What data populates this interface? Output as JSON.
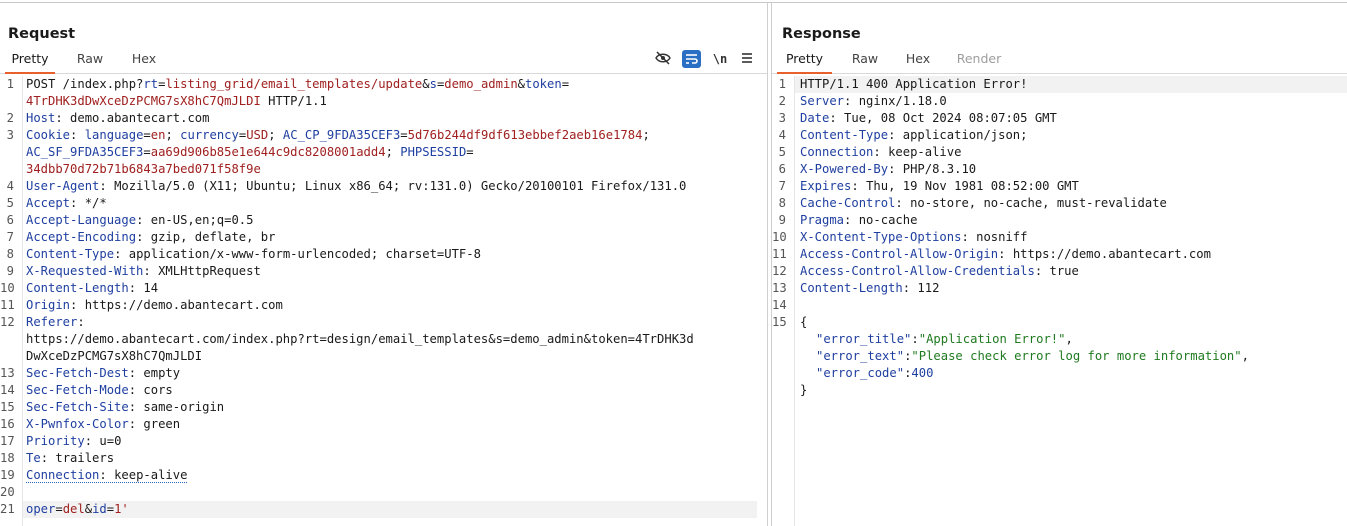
{
  "request": {
    "title": "Request",
    "tabs": [
      "Pretty",
      "Raw",
      "Hex"
    ],
    "toolbar_icons": [
      "eye-slash-icon",
      "wrap-lines-icon",
      "newline-icon",
      "menu-icon"
    ],
    "toolbar_newline_label": "\\n",
    "line_numbers": [
      "1",
      "2",
      "3",
      "4",
      "5",
      "6",
      "7",
      "8",
      "9",
      "10",
      "11",
      "12",
      "13",
      "14",
      "15",
      "16",
      "17",
      "18",
      "19",
      "20",
      "21"
    ],
    "lines": {
      "l1": {
        "method": "POST /index.php?",
        "rt_k": "rt",
        "eq": "=",
        "rt_v": "listing_grid/email_templates/update",
        "amp1": "&",
        "s_k": "s",
        "s_v": "demo_admin",
        "amp2": "&",
        "t_k": "token",
        "t_eq": "="
      },
      "l1b": {
        "token_v": "4TrDHK3dDwXceDzPCMG7sX8hC7QmJLDI",
        "proto": " HTTP/1.1"
      },
      "l2": {
        "k": "Host",
        "v": "demo.abantecart.com"
      },
      "l3": {
        "k": "Cookie",
        "c1k": "language",
        "c1v": "en",
        "c2k": "currency",
        "c2v": "USD",
        "c3k": "AC_CP_9FDA35CEF3",
        "c3v": "5d76b244df9df613ebbef2aeb16e1784"
      },
      "l3b": {
        "c4k": "AC_SF_9FDA35CEF3",
        "c4v": "aa69d906b85e1e644c9dc8208001add4",
        "c5k": "PHPSESSID"
      },
      "l3c": {
        "c5v": "34dbb70d72b71b6843a7bed071f58f9e"
      },
      "l4": {
        "k": "User-Agent",
        "v": "Mozilla/5.0 (X11; Ubuntu; Linux x86_64; rv:131.0) Gecko/20100101 Firefox/131.0"
      },
      "l5": {
        "k": "Accept",
        "v": "*/*"
      },
      "l6": {
        "k": "Accept-Language",
        "v": "en-US,en;q=0.5"
      },
      "l7": {
        "k": "Accept-Encoding",
        "v": "gzip, deflate, br"
      },
      "l8": {
        "k": "Content-Type",
        "v": "application/x-www-form-urlencoded; charset=UTF-8"
      },
      "l9": {
        "k": "X-Requested-With",
        "v": "XMLHttpRequest"
      },
      "l10": {
        "k": "Content-Length",
        "v": "14"
      },
      "l11": {
        "k": "Origin",
        "v": "https://demo.abantecart.com"
      },
      "l12": {
        "k": "Referer",
        "v1": "https://demo.abantecart.com/index.php?rt=design/email_templates&s=demo_admin&token=4TrDHK3d",
        "v2": "DwXceDzPCMG7sX8hC7QmJLDI"
      },
      "l13": {
        "k": "Sec-Fetch-Dest",
        "v": "empty"
      },
      "l14": {
        "k": "Sec-Fetch-Mode",
        "v": "cors"
      },
      "l15": {
        "k": "Sec-Fetch-Site",
        "v": "same-origin"
      },
      "l16": {
        "k": "X-Pwnfox-Color",
        "v": "green"
      },
      "l17": {
        "k": "Priority",
        "v": "u=0"
      },
      "l18": {
        "k": "Te",
        "v": "trailers"
      },
      "l19": {
        "k": "Connection",
        "v": "keep-alive"
      },
      "l21": {
        "p1k": "oper",
        "p1v": "del",
        "amp": "&",
        "p2k": "id",
        "p2v": "1'"
      }
    }
  },
  "response": {
    "title": "Response",
    "tabs": [
      "Pretty",
      "Raw",
      "Hex",
      "Render"
    ],
    "line_numbers": [
      "1",
      "2",
      "3",
      "4",
      "5",
      "6",
      "7",
      "8",
      "9",
      "10",
      "11",
      "12",
      "13",
      "14",
      "15"
    ],
    "lines": {
      "l1": "HTTP/1.1 400 Application Error!",
      "l2": {
        "k": "Server",
        "v": "nginx/1.18.0"
      },
      "l3": {
        "k": "Date",
        "v": "Tue, 08 Oct 2024 08:07:05 GMT"
      },
      "l4": {
        "k": "Content-Type",
        "v": "application/json;"
      },
      "l5": {
        "k": "Connection",
        "v": "keep-alive"
      },
      "l6": {
        "k": "X-Powered-By",
        "v": "PHP/8.3.10"
      },
      "l7": {
        "k": "Expires",
        "v": "Thu, 19 Nov 1981 08:52:00 GMT"
      },
      "l8": {
        "k": "Cache-Control",
        "v": "no-store, no-cache, must-revalidate"
      },
      "l9": {
        "k": "Pragma",
        "v": "no-cache"
      },
      "l10": {
        "k": "X-Content-Type-Options",
        "v": "nosniff"
      },
      "l11": {
        "k": "Access-Control-Allow-Origin",
        "v": "https://demo.abantecart.com"
      },
      "l12": {
        "k": "Access-Control-Allow-Credentials",
        "v": "true"
      },
      "l13": {
        "k": "Content-Length",
        "v": "112"
      },
      "l15": "{",
      "json": [
        {
          "k": "\"error_title\"",
          "v": "\"Application Error!\"",
          "comma": ","
        },
        {
          "k": "\"error_text\"",
          "v": "\"Please check error log for more information\"",
          "comma": ","
        },
        {
          "k": "\"error_code\"",
          "v": "400",
          "comma": ""
        }
      ],
      "close": "}"
    }
  },
  "colors": {
    "accent": "#e8612c",
    "key": "#1f3fa0",
    "value": "#a02020",
    "string": "#207a20"
  }
}
